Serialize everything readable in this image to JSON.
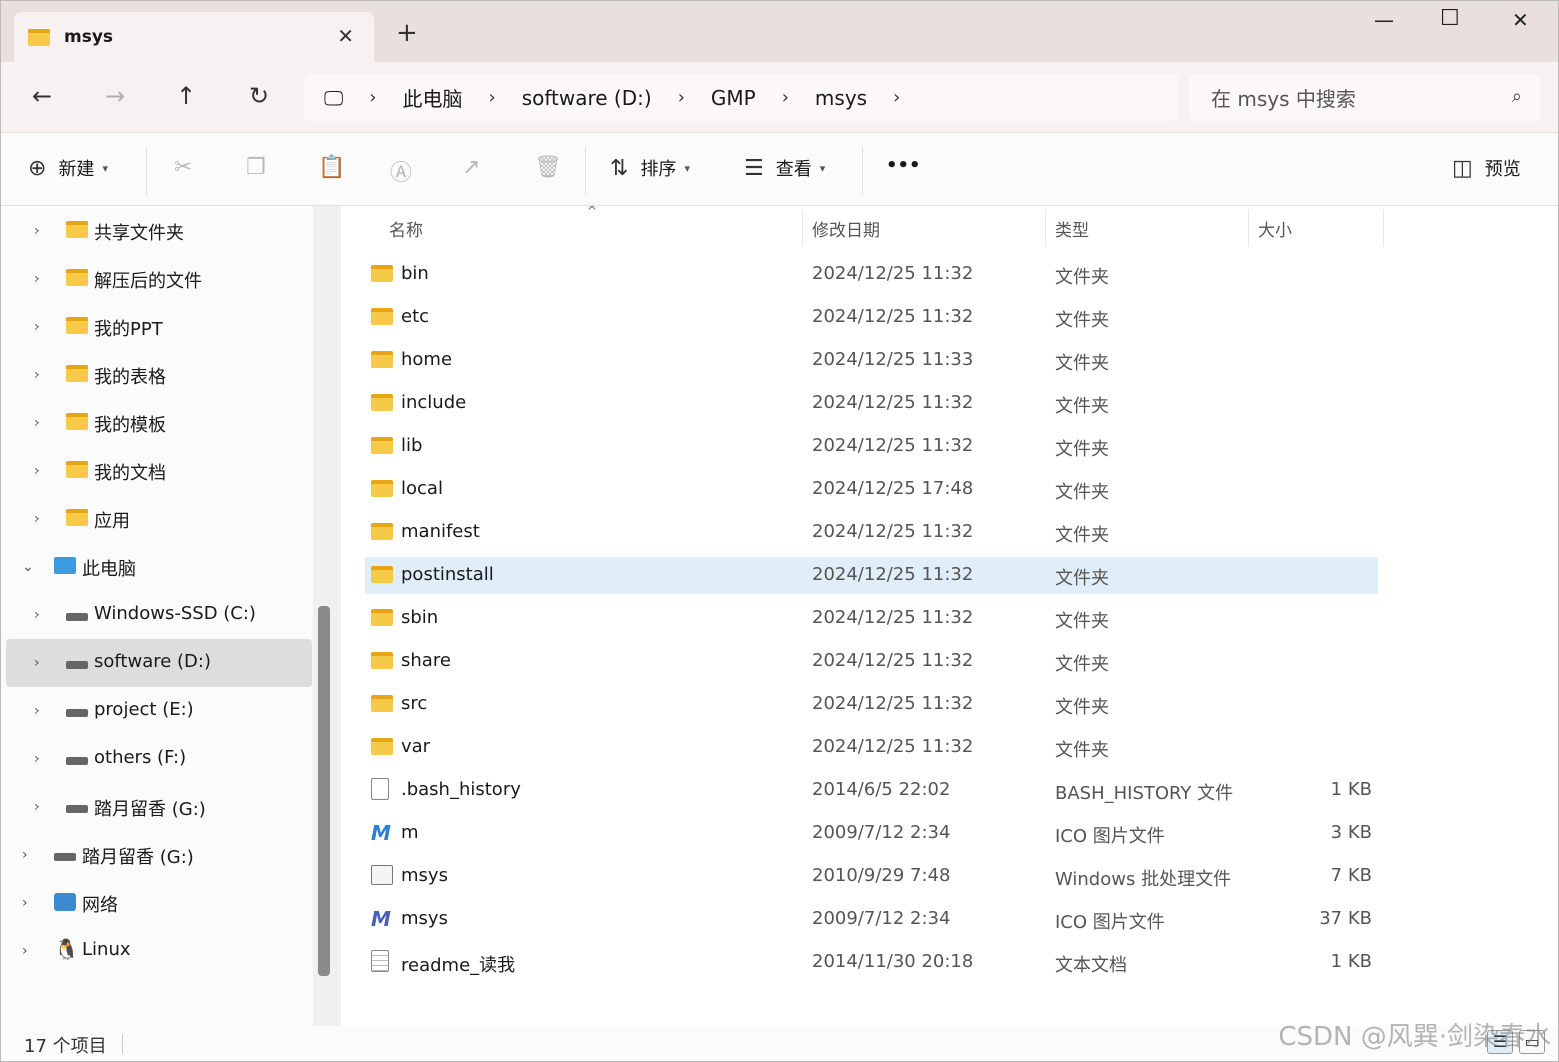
{
  "window": {
    "tab_title": "msys",
    "new_tab_label": "+",
    "close_tab_glyph": "✕",
    "minimize_glyph": "—",
    "maximize_glyph": "☐",
    "close_glyph": "✕"
  },
  "nav": {
    "back_glyph": "←",
    "forward_glyph": "→",
    "up_glyph": "↑",
    "refresh_glyph": "↻"
  },
  "breadcrumb": {
    "items": [
      "此电脑",
      "software (D:)",
      "GMP",
      "msys"
    ],
    "separator": "›",
    "root_icon": "monitor-icon"
  },
  "search": {
    "placeholder": "在 msys 中搜索"
  },
  "toolbar": {
    "new_label": "新建",
    "sort_label": "排序",
    "view_label": "查看",
    "more_label": "•••",
    "preview_label": "预览"
  },
  "sidebar": {
    "items": [
      {
        "label": "共享文件夹",
        "icon": "shared-folder-icon"
      },
      {
        "label": "解压后的文件",
        "icon": "folder-icon"
      },
      {
        "label": "我的PPT",
        "icon": "folder-icon"
      },
      {
        "label": "我的表格",
        "icon": "folder-icon"
      },
      {
        "label": "我的模板",
        "icon": "folder-icon"
      },
      {
        "label": "我的文档",
        "icon": "folder-icon"
      },
      {
        "label": "应用",
        "icon": "apps-folder-icon"
      },
      {
        "label": "此电脑",
        "icon": "pc-icon"
      },
      {
        "label": "Windows-SSD (C:)",
        "icon": "windows-drive-icon"
      },
      {
        "label": "software (D:)",
        "icon": "drive-icon"
      },
      {
        "label": "project (E:)",
        "icon": "drive-icon"
      },
      {
        "label": "others (F:)",
        "icon": "drive-icon"
      },
      {
        "label": "踏月留香 (G:)",
        "icon": "drive-icon"
      },
      {
        "label": "踏月留香 (G:)",
        "icon": "drive-icon"
      },
      {
        "label": "网络",
        "icon": "network-icon"
      },
      {
        "label": "Linux",
        "icon": "linux-icon"
      }
    ]
  },
  "columns": {
    "name": "名称",
    "date": "修改日期",
    "type": "类型",
    "size": "大小"
  },
  "files": [
    {
      "name": "bin",
      "date": "2024/12/25 11:32",
      "type": "文件夹",
      "size": "",
      "icon": "folder-icon"
    },
    {
      "name": "etc",
      "date": "2024/12/25 11:32",
      "type": "文件夹",
      "size": "",
      "icon": "folder-icon"
    },
    {
      "name": "home",
      "date": "2024/12/25 11:33",
      "type": "文件夹",
      "size": "",
      "icon": "folder-icon"
    },
    {
      "name": "include",
      "date": "2024/12/25 11:32",
      "type": "文件夹",
      "size": "",
      "icon": "folder-icon"
    },
    {
      "name": "lib",
      "date": "2024/12/25 11:32",
      "type": "文件夹",
      "size": "",
      "icon": "folder-icon"
    },
    {
      "name": "local",
      "date": "2024/12/25 17:48",
      "type": "文件夹",
      "size": "",
      "icon": "folder-icon"
    },
    {
      "name": "manifest",
      "date": "2024/12/25 11:32",
      "type": "文件夹",
      "size": "",
      "icon": "folder-icon"
    },
    {
      "name": "postinstall",
      "date": "2024/12/25 11:32",
      "type": "文件夹",
      "size": "",
      "icon": "folder-icon"
    },
    {
      "name": "sbin",
      "date": "2024/12/25 11:32",
      "type": "文件夹",
      "size": "",
      "icon": "folder-icon"
    },
    {
      "name": "share",
      "date": "2024/12/25 11:32",
      "type": "文件夹",
      "size": "",
      "icon": "folder-icon"
    },
    {
      "name": "src",
      "date": "2024/12/25 11:32",
      "type": "文件夹",
      "size": "",
      "icon": "folder-icon"
    },
    {
      "name": "var",
      "date": "2024/12/25 11:32",
      "type": "文件夹",
      "size": "",
      "icon": "folder-icon"
    },
    {
      "name": ".bash_history",
      "date": "2014/6/5 22:02",
      "type": "BASH_HISTORY 文件",
      "size": "1 KB",
      "icon": "file-icon"
    },
    {
      "name": "m",
      "date": "2009/7/12 2:34",
      "type": "ICO 图片文件",
      "size": "3 KB",
      "icon": "msys-m-icon"
    },
    {
      "name": "msys",
      "date": "2010/9/29 7:48",
      "type": "Windows 批处理文件",
      "size": "7 KB",
      "icon": "batch-file-icon"
    },
    {
      "name": "msys",
      "date": "2009/7/12 2:34",
      "type": "ICO 图片文件",
      "size": "37 KB",
      "icon": "msys-ico-icon"
    },
    {
      "name": "readme_读我",
      "date": "2014/11/30 20:18",
      "type": "文本文档",
      "size": "1 KB",
      "icon": "text-file-icon"
    }
  ],
  "status": {
    "item_count": "17 个项目"
  },
  "watermark": "CSDN @风巽·剑染春水"
}
